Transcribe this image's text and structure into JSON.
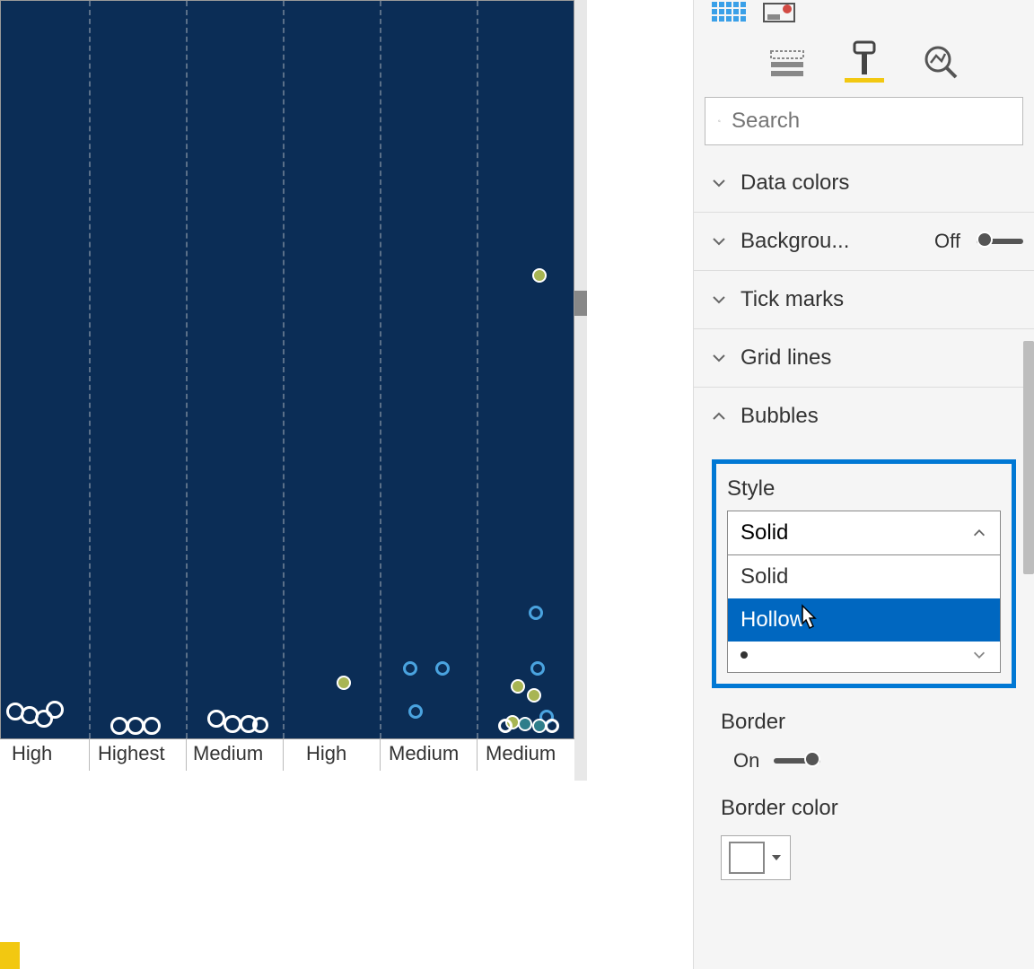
{
  "search": {
    "placeholder": "Search"
  },
  "sections": {
    "data_colors": "Data colors",
    "background": "Backgrou...",
    "background_toggle": "Off",
    "tick_marks": "Tick marks",
    "grid_lines": "Grid lines",
    "bubbles": "Bubbles"
  },
  "bubbles_panel": {
    "style_label": "Style",
    "selected": "Solid",
    "options": [
      "Solid",
      "Hollow"
    ],
    "border_label": "Border",
    "border_toggle": "On",
    "border_color_label": "Border color"
  },
  "chart_data": {
    "type": "scatter",
    "xlabel": "",
    "ylabel": "",
    "categories": [
      "High",
      "Highest",
      "Medium",
      "High",
      "Medium",
      "Medium"
    ],
    "ylim": [
      0,
      100
    ],
    "series": [
      {
        "name": "olive",
        "points": [
          {
            "cat": 5,
            "y": 63,
            "style": "solid-olive"
          },
          {
            "cat": 3,
            "y": 8,
            "style": "solid-olive"
          },
          {
            "cat": 5,
            "y": 6,
            "style": "solid-olive"
          },
          {
            "cat": 5,
            "y": 3,
            "style": "solid-olive"
          },
          {
            "cat": 5,
            "y": 2.5,
            "style": "solid-olive"
          }
        ]
      },
      {
        "name": "blue-hollow",
        "points": [
          {
            "cat": 5,
            "y": 18,
            "style": "hollow-blue"
          },
          {
            "cat": 4,
            "y": 10,
            "style": "hollow-blue"
          },
          {
            "cat": 4,
            "y": 10.2,
            "style": "hollow-blue"
          },
          {
            "cat": 4,
            "y": 4,
            "style": "hollow-blue"
          },
          {
            "cat": 5,
            "y": 10,
            "style": "hollow-blue"
          },
          {
            "cat": 5,
            "y": 3.5,
            "style": "hollow-blue"
          }
        ]
      },
      {
        "name": "white-hollow",
        "points": [
          {
            "cat": 0,
            "y": 3.5,
            "style": "hollow-white"
          },
          {
            "cat": 0,
            "y": 3.2,
            "style": "hollow-white"
          },
          {
            "cat": 0,
            "y": 2.8,
            "style": "hollow-white"
          },
          {
            "cat": 0,
            "y": 3.6,
            "style": "hollow-white"
          },
          {
            "cat": 1,
            "y": 2.2,
            "style": "hollow-white"
          },
          {
            "cat": 1,
            "y": 2.1,
            "style": "hollow-white"
          },
          {
            "cat": 1,
            "y": 2.0,
            "style": "hollow-white"
          },
          {
            "cat": 2,
            "y": 2.5,
            "style": "hollow-white"
          },
          {
            "cat": 2,
            "y": 2.4,
            "style": "hollow-white"
          },
          {
            "cat": 2,
            "y": 2.3,
            "style": "hollow-white"
          },
          {
            "cat": 2,
            "y": 2.2,
            "style": "hollow-white"
          },
          {
            "cat": 5,
            "y": 2.0,
            "style": "hollow-white"
          },
          {
            "cat": 5,
            "y": 2.2,
            "style": "hollow-white"
          }
        ]
      },
      {
        "name": "teal",
        "points": [
          {
            "cat": 5,
            "y": 2.4,
            "style": "solid-teal"
          },
          {
            "cat": 5,
            "y": 2.6,
            "style": "solid-teal"
          }
        ]
      }
    ]
  }
}
